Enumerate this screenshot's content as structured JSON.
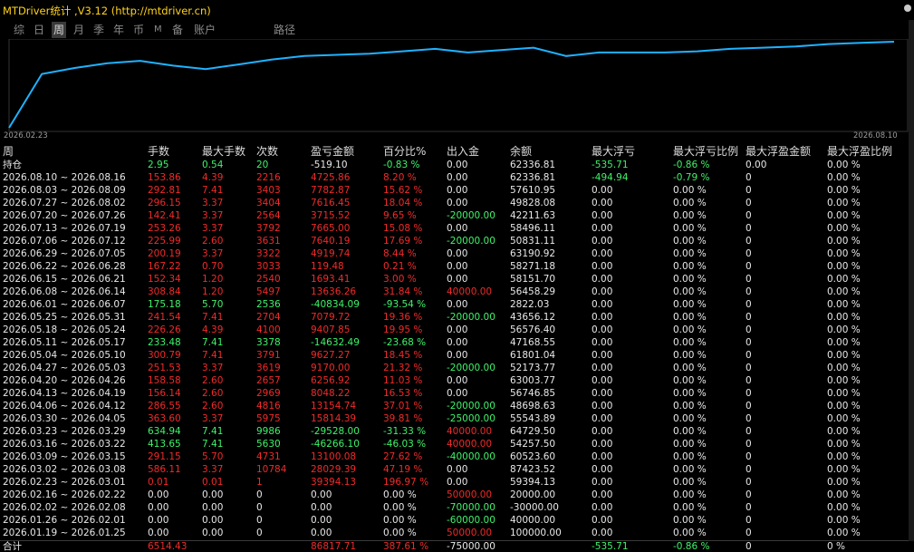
{
  "title": "MTDriver统计 ,V3.12 (http://mtdriver.cn)",
  "tabs": [
    {
      "label": "综",
      "active": false,
      "small": false
    },
    {
      "label": "日",
      "active": false,
      "small": false
    },
    {
      "label": "周",
      "active": true,
      "small": false
    },
    {
      "label": "月",
      "active": false,
      "small": false
    },
    {
      "label": "季",
      "active": false,
      "small": false
    },
    {
      "label": "年",
      "active": false,
      "small": false
    },
    {
      "label": "币",
      "active": false,
      "small": false
    },
    {
      "label": "M",
      "active": false,
      "small": true
    },
    {
      "label": "备",
      "active": false,
      "small": false
    },
    {
      "label": "账户",
      "active": false,
      "small": false
    },
    {
      "label": "路径",
      "active": false,
      "small": false
    }
  ],
  "chart": {
    "start_label": "2026.02.23",
    "end_label": "2026.08.10",
    "line_color": "#1fb2ff",
    "values": [
      0,
      45,
      50,
      54,
      56,
      52,
      49,
      53,
      57,
      60,
      61,
      62,
      64,
      66,
      63,
      65,
      67,
      60,
      63,
      63,
      63,
      64,
      66,
      67,
      68,
      70,
      71,
      72
    ]
  },
  "columns": [
    "周",
    "手数",
    "最大手数",
    "次数",
    "盈亏金额",
    "百分比%",
    "出入金",
    "余额",
    "最大浮亏",
    "最大浮亏比例",
    "最大浮盈金额",
    "最大浮盈比例"
  ],
  "colors": {
    "red": "#f02a2a",
    "green": "#3ff26a",
    "white": "#e8e8e8"
  },
  "holding": {
    "period": "持仓",
    "lots": "2.95",
    "max_lots": "0.54",
    "count": "20",
    "pnl": "-519.10",
    "pct": "-0.83 %",
    "flow": "0.00",
    "balance": "62336.81",
    "max_dd": "-535.71",
    "max_dd_pct": "-0.86 %",
    "max_fp": "0.00",
    "max_fp_pct": "0.00 %"
  },
  "weeks": [
    {
      "period": "2026.08.10 ~ 2026.08.16",
      "lots": "153.86",
      "max_lots": "4.39",
      "count": "2216",
      "pnl": "4725.86",
      "pct": "8.20 %",
      "flow": "0.00",
      "balance": "62336.81",
      "max_dd": "-494.94",
      "max_dd_pct": "-0.79 %",
      "max_fp": "0",
      "max_fp_pct": "0.00 %",
      "c": "red"
    },
    {
      "period": "2026.08.03 ~ 2026.08.09",
      "lots": "292.81",
      "max_lots": "7.41",
      "count": "3403",
      "pnl": "7782.87",
      "pct": "15.62 %",
      "flow": "0.00",
      "balance": "57610.95",
      "max_dd": "0.00",
      "max_dd_pct": "0.00 %",
      "max_fp": "0",
      "max_fp_pct": "0.00 %",
      "c": "red"
    },
    {
      "period": "2026.07.27 ~ 2026.08.02",
      "lots": "296.15",
      "max_lots": "3.37",
      "count": "3404",
      "pnl": "7616.45",
      "pct": "18.04 %",
      "flow": "0.00",
      "balance": "49828.08",
      "max_dd": "0.00",
      "max_dd_pct": "0.00 %",
      "max_fp": "0",
      "max_fp_pct": "0.00 %",
      "c": "red"
    },
    {
      "period": "2026.07.20 ~ 2026.07.26",
      "lots": "142.41",
      "max_lots": "3.37",
      "count": "2564",
      "pnl": "3715.52",
      "pct": "9.65 %",
      "flow": "-20000.00",
      "balance": "42211.63",
      "max_dd": "0.00",
      "max_dd_pct": "0.00 %",
      "max_fp": "0",
      "max_fp_pct": "0.00 %",
      "c": "red"
    },
    {
      "period": "2026.07.13 ~ 2026.07.19",
      "lots": "253.26",
      "max_lots": "3.37",
      "count": "3792",
      "pnl": "7665.00",
      "pct": "15.08 %",
      "flow": "0.00",
      "balance": "58496.11",
      "max_dd": "0.00",
      "max_dd_pct": "0.00 %",
      "max_fp": "0",
      "max_fp_pct": "0.00 %",
      "c": "red"
    },
    {
      "period": "2026.07.06 ~ 2026.07.12",
      "lots": "225.99",
      "max_lots": "2.60",
      "count": "3631",
      "pnl": "7640.19",
      "pct": "17.69 %",
      "flow": "-20000.00",
      "balance": "50831.11",
      "max_dd": "0.00",
      "max_dd_pct": "0.00 %",
      "max_fp": "0",
      "max_fp_pct": "0.00 %",
      "c": "red"
    },
    {
      "period": "2026.06.29 ~ 2026.07.05",
      "lots": "200.19",
      "max_lots": "3.37",
      "count": "3322",
      "pnl": "4919.74",
      "pct": "8.44 %",
      "flow": "0.00",
      "balance": "63190.92",
      "max_dd": "0.00",
      "max_dd_pct": "0.00 %",
      "max_fp": "0",
      "max_fp_pct": "0.00 %",
      "c": "red"
    },
    {
      "period": "2026.06.22 ~ 2026.06.28",
      "lots": "167.22",
      "max_lots": "0.70",
      "count": "3033",
      "pnl": "119.48",
      "pct": "0.21 %",
      "flow": "0.00",
      "balance": "58271.18",
      "max_dd": "0.00",
      "max_dd_pct": "0.00 %",
      "max_fp": "0",
      "max_fp_pct": "0.00 %",
      "c": "red"
    },
    {
      "period": "2026.06.15 ~ 2026.06.21",
      "lots": "152.34",
      "max_lots": "1.20",
      "count": "2540",
      "pnl": "1693.41",
      "pct": "3.00 %",
      "flow": "0.00",
      "balance": "58151.70",
      "max_dd": "0.00",
      "max_dd_pct": "0.00 %",
      "max_fp": "0",
      "max_fp_pct": "0.00 %",
      "c": "red"
    },
    {
      "period": "2026.06.08 ~ 2026.06.14",
      "lots": "308.84",
      "max_lots": "1.20",
      "count": "5497",
      "pnl": "13636.26",
      "pct": "31.84 %",
      "flow": "40000.00",
      "balance": "56458.29",
      "max_dd": "0.00",
      "max_dd_pct": "0.00 %",
      "max_fp": "0",
      "max_fp_pct": "0.00 %",
      "c": "red"
    },
    {
      "period": "2026.06.01 ~ 2026.06.07",
      "lots": "175.18",
      "max_lots": "5.70",
      "count": "2536",
      "pnl": "-40834.09",
      "pct": "-93.54 %",
      "flow": "0.00",
      "balance": "2822.03",
      "max_dd": "0.00",
      "max_dd_pct": "0.00 %",
      "max_fp": "0",
      "max_fp_pct": "0.00 %",
      "c": "green"
    },
    {
      "period": "2026.05.25 ~ 2026.05.31",
      "lots": "241.54",
      "max_lots": "7.41",
      "count": "2704",
      "pnl": "7079.72",
      "pct": "19.36 %",
      "flow": "-20000.00",
      "balance": "43656.12",
      "max_dd": "0.00",
      "max_dd_pct": "0.00 %",
      "max_fp": "0",
      "max_fp_pct": "0.00 %",
      "c": "red"
    },
    {
      "period": "2026.05.18 ~ 2026.05.24",
      "lots": "226.26",
      "max_lots": "4.39",
      "count": "4100",
      "pnl": "9407.85",
      "pct": "19.95 %",
      "flow": "0.00",
      "balance": "56576.40",
      "max_dd": "0.00",
      "max_dd_pct": "0.00 %",
      "max_fp": "0",
      "max_fp_pct": "0.00 %",
      "c": "red"
    },
    {
      "period": "2026.05.11 ~ 2026.05.17",
      "lots": "233.48",
      "max_lots": "7.41",
      "count": "3378",
      "pnl": "-14632.49",
      "pct": "-23.68 %",
      "flow": "0.00",
      "balance": "47168.55",
      "max_dd": "0.00",
      "max_dd_pct": "0.00 %",
      "max_fp": "0",
      "max_fp_pct": "0.00 %",
      "c": "green"
    },
    {
      "period": "2026.05.04 ~ 2026.05.10",
      "lots": "300.79",
      "max_lots": "7.41",
      "count": "3791",
      "pnl": "9627.27",
      "pct": "18.45 %",
      "flow": "0.00",
      "balance": "61801.04",
      "max_dd": "0.00",
      "max_dd_pct": "0.00 %",
      "max_fp": "0",
      "max_fp_pct": "0.00 %",
      "c": "red"
    },
    {
      "period": "2026.04.27 ~ 2026.05.03",
      "lots": "251.53",
      "max_lots": "3.37",
      "count": "3619",
      "pnl": "9170.00",
      "pct": "21.32 %",
      "flow": "-20000.00",
      "balance": "52173.77",
      "max_dd": "0.00",
      "max_dd_pct": "0.00 %",
      "max_fp": "0",
      "max_fp_pct": "0.00 %",
      "c": "red"
    },
    {
      "period": "2026.04.20 ~ 2026.04.26",
      "lots": "158.58",
      "max_lots": "2.60",
      "count": "2657",
      "pnl": "6256.92",
      "pct": "11.03 %",
      "flow": "0.00",
      "balance": "63003.77",
      "max_dd": "0.00",
      "max_dd_pct": "0.00 %",
      "max_fp": "0",
      "max_fp_pct": "0.00 %",
      "c": "red"
    },
    {
      "period": "2026.04.13 ~ 2026.04.19",
      "lots": "156.14",
      "max_lots": "2.60",
      "count": "2969",
      "pnl": "8048.22",
      "pct": "16.53 %",
      "flow": "0.00",
      "balance": "56746.85",
      "max_dd": "0.00",
      "max_dd_pct": "0.00 %",
      "max_fp": "0",
      "max_fp_pct": "0.00 %",
      "c": "red"
    },
    {
      "period": "2026.04.06 ~ 2026.04.12",
      "lots": "286.55",
      "max_lots": "2.60",
      "count": "4816",
      "pnl": "13154.74",
      "pct": "37.01 %",
      "flow": "-20000.00",
      "balance": "48698.63",
      "max_dd": "0.00",
      "max_dd_pct": "0.00 %",
      "max_fp": "0",
      "max_fp_pct": "0.00 %",
      "c": "red"
    },
    {
      "period": "2026.03.30 ~ 2026.04.05",
      "lots": "363.60",
      "max_lots": "3.37",
      "count": "5975",
      "pnl": "15814.39",
      "pct": "39.81 %",
      "flow": "-25000.00",
      "balance": "55543.89",
      "max_dd": "0.00",
      "max_dd_pct": "0.00 %",
      "max_fp": "0",
      "max_fp_pct": "0.00 %",
      "c": "red"
    },
    {
      "period": "2026.03.23 ~ 2026.03.29",
      "lots": "634.94",
      "max_lots": "7.41",
      "count": "9986",
      "pnl": "-29528.00",
      "pct": "-31.33 %",
      "flow": "40000.00",
      "balance": "64729.50",
      "max_dd": "0.00",
      "max_dd_pct": "0.00 %",
      "max_fp": "0",
      "max_fp_pct": "0.00 %",
      "c": "green"
    },
    {
      "period": "2026.03.16 ~ 2026.03.22",
      "lots": "413.65",
      "max_lots": "7.41",
      "count": "5630",
      "pnl": "-46266.10",
      "pct": "-46.03 %",
      "flow": "40000.00",
      "balance": "54257.50",
      "max_dd": "0.00",
      "max_dd_pct": "0.00 %",
      "max_fp": "0",
      "max_fp_pct": "0.00 %",
      "c": "green"
    },
    {
      "period": "2026.03.09 ~ 2026.03.15",
      "lots": "291.15",
      "max_lots": "5.70",
      "count": "4731",
      "pnl": "13100.08",
      "pct": "27.62 %",
      "flow": "-40000.00",
      "balance": "60523.60",
      "max_dd": "0.00",
      "max_dd_pct": "0.00 %",
      "max_fp": "0",
      "max_fp_pct": "0.00 %",
      "c": "red"
    },
    {
      "period": "2026.03.02 ~ 2026.03.08",
      "lots": "586.11",
      "max_lots": "3.37",
      "count": "10784",
      "pnl": "28029.39",
      "pct": "47.19 %",
      "flow": "0.00",
      "balance": "87423.52",
      "max_dd": "0.00",
      "max_dd_pct": "0.00 %",
      "max_fp": "0",
      "max_fp_pct": "0.00 %",
      "c": "red"
    },
    {
      "period": "2026.02.23 ~ 2026.03.01",
      "lots": "0.01",
      "max_lots": "0.01",
      "count": "1",
      "pnl": "39394.13",
      "pct": "196.97 %",
      "flow": "0.00",
      "balance": "59394.13",
      "max_dd": "0.00",
      "max_dd_pct": "0.00 %",
      "max_fp": "0",
      "max_fp_pct": "0.00 %",
      "c": "red"
    },
    {
      "period": "2026.02.16 ~ 2026.02.22",
      "lots": "0.00",
      "max_lots": "0.00",
      "count": "0",
      "pnl": "0.00",
      "pct": "0.00 %",
      "flow": "50000.00",
      "balance": "20000.00",
      "max_dd": "0.00",
      "max_dd_pct": "0.00 %",
      "max_fp": "0",
      "max_fp_pct": "0.00 %",
      "c": "white"
    },
    {
      "period": "2026.02.02 ~ 2026.02.08",
      "lots": "0.00",
      "max_lots": "0.00",
      "count": "0",
      "pnl": "0.00",
      "pct": "0.00 %",
      "flow": "-70000.00",
      "balance": "-30000.00",
      "max_dd": "0.00",
      "max_dd_pct": "0.00 %",
      "max_fp": "0",
      "max_fp_pct": "0.00 %",
      "c": "white"
    },
    {
      "period": "2026.01.26 ~ 2026.02.01",
      "lots": "0.00",
      "max_lots": "0.00",
      "count": "0",
      "pnl": "0.00",
      "pct": "0.00 %",
      "flow": "-60000.00",
      "balance": "40000.00",
      "max_dd": "0.00",
      "max_dd_pct": "0.00 %",
      "max_fp": "0",
      "max_fp_pct": "0.00 %",
      "c": "white"
    },
    {
      "period": "2026.01.19 ~ 2026.01.25",
      "lots": "0.00",
      "max_lots": "0.00",
      "count": "0",
      "pnl": "0.00",
      "pct": "0.00 %",
      "flow": "50000.00",
      "balance": "100000.00",
      "max_dd": "0.00",
      "max_dd_pct": "0.00 %",
      "max_fp": "0",
      "max_fp_pct": "0.00 %",
      "c": "white"
    }
  ],
  "total": {
    "label": "合计",
    "lots": "6514.43",
    "pnl": "86817.71",
    "pct": "387.61 %",
    "flow": "-75000.00",
    "max_dd": "-535.71",
    "max_dd_pct": "-0.86 %",
    "max_fp": "0",
    "max_fp_pct": "0 %"
  }
}
